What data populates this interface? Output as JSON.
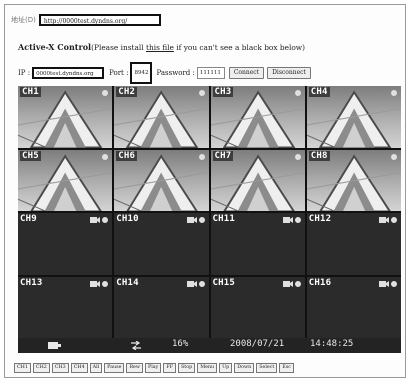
{
  "address_bar": {
    "label": "地址(D)",
    "url": "http://0000test.dyndns.org/"
  },
  "heading": {
    "title": "Active-X Control",
    "pre": "(Please install ",
    "link": "this file",
    "post": " if you can't see a black box below)"
  },
  "connection": {
    "ip_label": "IP :",
    "ip_value": "0000test.dyndns.org",
    "port_label": "Port :",
    "port_value": "8942",
    "password_label": "Password :",
    "password_value": "111111",
    "connect_label": "Connect",
    "disconnect_label": "Disconnect"
  },
  "channels": [
    {
      "label": "CH1",
      "type": "image"
    },
    {
      "label": "CH2",
      "type": "image"
    },
    {
      "label": "CH3",
      "type": "image"
    },
    {
      "label": "CH4",
      "type": "image"
    },
    {
      "label": "CH5",
      "type": "image"
    },
    {
      "label": "CH6",
      "type": "image"
    },
    {
      "label": "CH7",
      "type": "image"
    },
    {
      "label": "CH8",
      "type": "image"
    },
    {
      "label": "CH9",
      "type": "empty"
    },
    {
      "label": "CH10",
      "type": "empty"
    },
    {
      "label": "CH11",
      "type": "empty"
    },
    {
      "label": "CH12",
      "type": "empty"
    },
    {
      "label": "CH13",
      "type": "empty"
    },
    {
      "label": "CH14",
      "type": "empty"
    },
    {
      "label": "CH15",
      "type": "empty"
    },
    {
      "label": "CH16",
      "type": "empty"
    }
  ],
  "status": {
    "hdd_percent": "16%",
    "date": "2008/07/21",
    "time": "14:48:25"
  },
  "controls": [
    "CH1",
    "CH2",
    "CH3",
    "CH4",
    "All",
    "Pause",
    "Rew",
    "Play",
    "FF",
    "Stop",
    "Menu",
    "Up",
    "Down",
    "Select",
    "Esc"
  ],
  "colors": {
    "viewer_bg": "#1e1e1e",
    "label_text": "#ffffff"
  }
}
